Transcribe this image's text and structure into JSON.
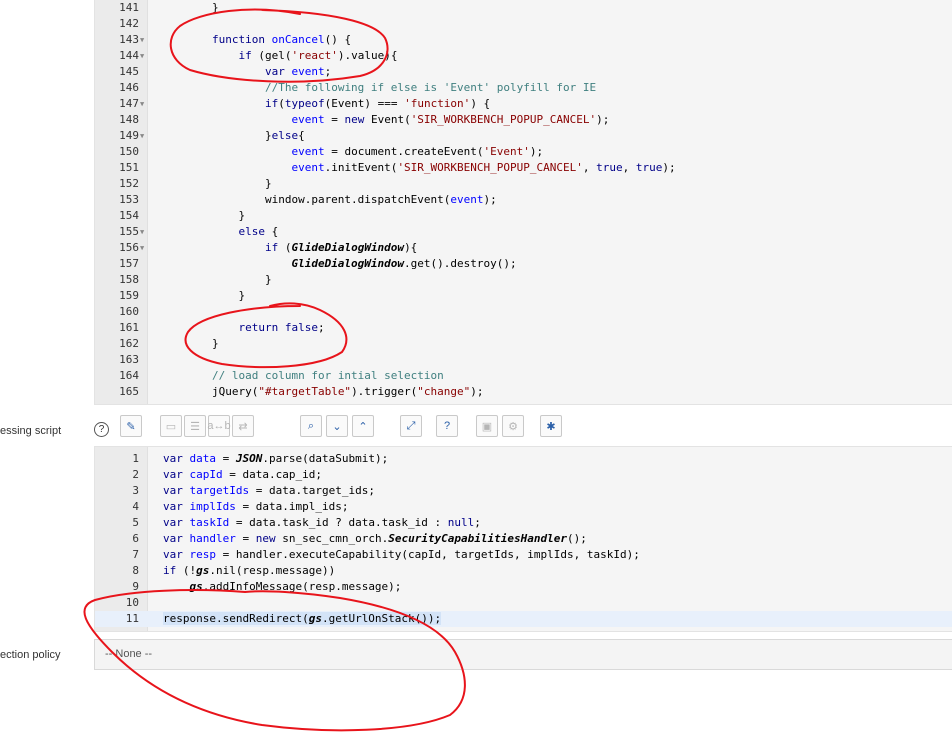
{
  "editor1": {
    "lines": [
      {
        "n": "141",
        "fold": false,
        "html": "        }"
      },
      {
        "n": "142",
        "fold": false,
        "html": ""
      },
      {
        "n": "143",
        "fold": true,
        "html": "        <span class='tk-kw'>function</span> <span class='tk-var'>onCancel</span>() {"
      },
      {
        "n": "144",
        "fold": true,
        "html": "            <span class='tk-kw'>if</span> (gel(<span class='tk-str'>'react'</span>).value){"
      },
      {
        "n": "145",
        "fold": false,
        "html": "                <span class='tk-kw'>var</span> <span class='tk-var'>event</span>;"
      },
      {
        "n": "146",
        "fold": false,
        "html": "                <span class='tk-com'>//The following if else is 'Event' polyfill for IE</span>"
      },
      {
        "n": "147",
        "fold": true,
        "html": "                <span class='tk-kw'>if</span>(<span class='tk-kw'>typeof</span>(Event) === <span class='tk-str'>'function'</span>) {"
      },
      {
        "n": "148",
        "fold": false,
        "html": "                    <span class='tk-var'>event</span> = <span class='tk-kw'>new</span> Event(<span class='tk-str'>'SIR_WORKBENCH_POPUP_CANCEL'</span>);"
      },
      {
        "n": "149",
        "fold": true,
        "html": "                }<span class='tk-kw'>else</span>{"
      },
      {
        "n": "150",
        "fold": false,
        "html": "                    <span class='tk-var'>event</span> = document.createEvent(<span class='tk-str'>'Event'</span>);"
      },
      {
        "n": "151",
        "fold": false,
        "html": "                    <span class='tk-var'>event</span>.initEvent(<span class='tk-str'>'SIR_WORKBENCH_POPUP_CANCEL'</span>, <span class='tk-kw'>true</span>, <span class='tk-kw'>true</span>);"
      },
      {
        "n": "152",
        "fold": false,
        "html": "                }"
      },
      {
        "n": "153",
        "fold": false,
        "html": "                window.parent.dispatchEvent(<span class='tk-var'>event</span>);"
      },
      {
        "n": "154",
        "fold": false,
        "html": "            }"
      },
      {
        "n": "155",
        "fold": true,
        "html": "            <span class='tk-kw'>else</span> {"
      },
      {
        "n": "156",
        "fold": true,
        "html": "                <span class='tk-kw'>if</span> (<span class='tk-it'>GlideDialogWindow</span>){"
      },
      {
        "n": "157",
        "fold": false,
        "html": "                    <span class='tk-it'>GlideDialogWindow</span>.get().destroy();"
      },
      {
        "n": "158",
        "fold": false,
        "html": "                }"
      },
      {
        "n": "159",
        "fold": false,
        "html": "            }"
      },
      {
        "n": "160",
        "fold": false,
        "html": ""
      },
      {
        "n": "161",
        "fold": false,
        "html": "            <span class='tk-kw'>return</span> <span class='tk-kw'>false</span>;"
      },
      {
        "n": "162",
        "fold": false,
        "html": "        }"
      },
      {
        "n": "163",
        "fold": false,
        "html": ""
      },
      {
        "n": "164",
        "fold": false,
        "html": "        <span class='tk-com'>// load column for intial selection</span>"
      },
      {
        "n": "165",
        "fold": false,
        "html": "        jQuery(<span class='tk-str'>\"#targetTable\"</span>).trigger(<span class='tk-str'>\"change\"</span>);"
      }
    ]
  },
  "labels": {
    "processing_script": "essing script",
    "protection_policy": "ection policy"
  },
  "toolbar": {
    "help": "?",
    "buttons": [
      {
        "name": "format-script-icon",
        "glyph": "✎",
        "state": "act"
      },
      {
        "name": "comment-icon",
        "glyph": "▭",
        "state": "dim"
      },
      {
        "name": "uncomment-icon",
        "glyph": "☰",
        "state": "dim"
      },
      {
        "name": "replace-icon",
        "glyph": "a↔b",
        "state": "dim"
      },
      {
        "name": "replace-all-icon",
        "glyph": "⇄",
        "state": "dim"
      },
      {
        "name": "search-icon",
        "glyph": "⌕",
        "state": "act"
      },
      {
        "name": "find-next-icon",
        "glyph": "⌄",
        "state": "act"
      },
      {
        "name": "find-previous-icon",
        "glyph": "⌃",
        "state": "act"
      },
      {
        "name": "fullscreen-icon",
        "glyph": "⤢",
        "state": "act"
      },
      {
        "name": "help-icon",
        "glyph": "?",
        "state": "act"
      },
      {
        "name": "save-icon",
        "glyph": "▣",
        "state": "dim"
      },
      {
        "name": "script-debug-icon",
        "glyph": "⚙",
        "state": "dim"
      },
      {
        "name": "bug-icon",
        "glyph": "✱",
        "state": "act"
      }
    ]
  },
  "editor2": {
    "lines": [
      {
        "n": "1",
        "html": "<span class='tk-kw'>var</span> <span class='tk-var'>data</span> = <span class='tk-it'>JSON</span>.parse(dataSubmit);"
      },
      {
        "n": "2",
        "html": "<span class='tk-kw'>var</span> <span class='tk-var'>capId</span> = data.cap_id;"
      },
      {
        "n": "3",
        "html": "<span class='tk-kw'>var</span> <span class='tk-var'>targetIds</span> = data.target_ids;"
      },
      {
        "n": "4",
        "html": "<span class='tk-kw'>var</span> <span class='tk-var'>implIds</span> = data.impl_ids;"
      },
      {
        "n": "5",
        "html": "<span class='tk-kw'>var</span> <span class='tk-var'>taskId</span> = data.task_id ? data.task_id : <span class='tk-kw'>null</span>;"
      },
      {
        "n": "6",
        "html": "<span class='tk-kw'>var</span> <span class='tk-var'>handler</span> = <span class='tk-kw'>new</span> sn_sec_cmn_orch.<span class='tk-it'>SecurityCapabilitiesHandler</span>();"
      },
      {
        "n": "7",
        "html": "<span class='tk-kw'>var</span> <span class='tk-var'>resp</span> = handler.executeCapability(capId, targetIds, implIds, taskId);"
      },
      {
        "n": "8",
        "html": "<span class='tk-kw'>if</span> (!<span class='tk-it'>gs</span>.nil(resp.message))"
      },
      {
        "n": "9",
        "html": "    <span class='tk-it'>gs</span>.addInfoMessage(resp.message);"
      },
      {
        "n": "10",
        "html": ""
      },
      {
        "n": "11",
        "html": "<span class='code-hl'>response.sendRedirect(<span class='tk-it'>gs</span>.getUrlOnStack());</span>"
      }
    ]
  },
  "policy": {
    "value": "-- None --"
  },
  "colors": {
    "annotation": "#e8141b",
    "keyword": "#000088",
    "string": "#880000",
    "variable": "#0000ff",
    "comment": "#3f7f7f"
  }
}
